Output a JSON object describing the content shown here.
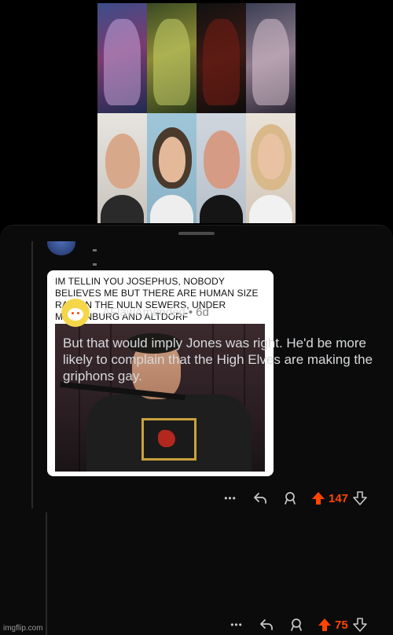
{
  "collage": {
    "monsters": [
      "monster-1",
      "monster-2",
      "monster-3",
      "monster-4"
    ],
    "people": [
      "person-1",
      "person-2",
      "person-3",
      "person-4"
    ]
  },
  "post": {
    "meme_caption": "IM TELLIN YOU JOSEPHUS, NOBODY BELIEVES ME BUT THERE ARE HUMAN SIZE RATS IN THE NULN SEWERS, UNDER MARIENBURG AND ALTDORF",
    "more_label": "•••",
    "vote_count": "147",
    "icons": [
      "more-icon",
      "reply-icon",
      "award-icon",
      "upvote-icon",
      "downvote-icon"
    ]
  },
  "comment": {
    "username": "AFlawAmended",
    "separator": "•",
    "age": "6d",
    "body": "But that would imply Jones was right. He'd be more likely to complain that the High Elves are making the griphons gay.",
    "more_label": "•••",
    "vote_count": "75"
  },
  "watermark": "imgflip.com",
  "colors": {
    "accent": "#ff4500",
    "panel_bg": "#0b0b0c",
    "text": "#d7dadc",
    "muted": "#818384"
  }
}
